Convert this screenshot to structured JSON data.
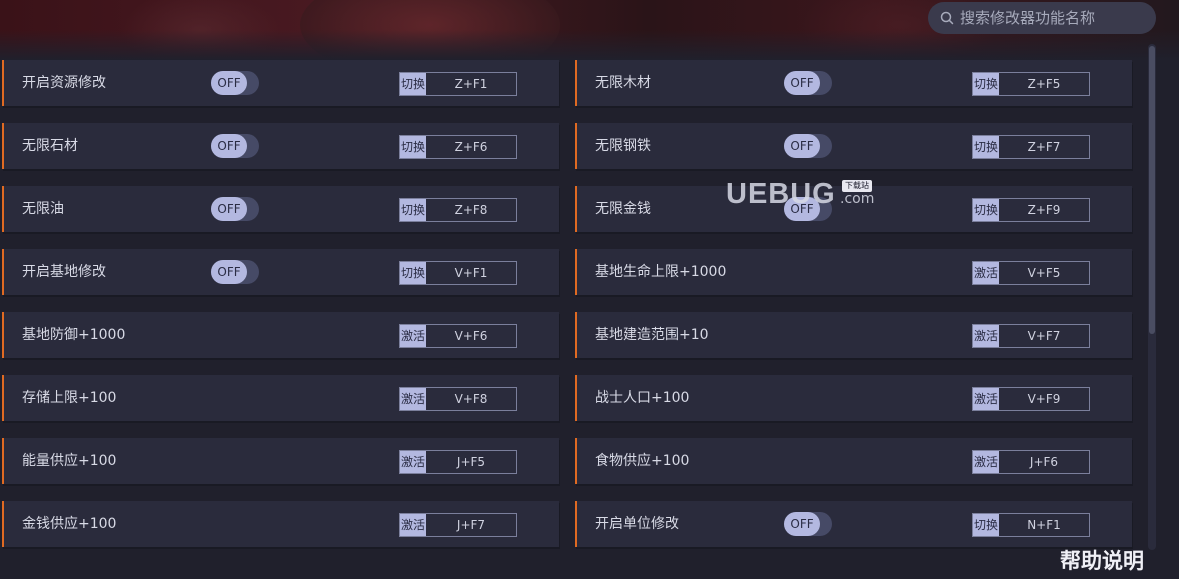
{
  "search": {
    "placeholder": "搜索修改器功能名称"
  },
  "toggle_off_label": "OFF",
  "rows_left": [
    {
      "label": "开启资源修改",
      "toggle": true,
      "action": "切换",
      "key": "Z+F1"
    },
    {
      "label": "无限石材",
      "toggle": true,
      "action": "切换",
      "key": "Z+F6"
    },
    {
      "label": "无限油",
      "toggle": true,
      "action": "切换",
      "key": "Z+F8"
    },
    {
      "label": "开启基地修改",
      "toggle": true,
      "action": "切换",
      "key": "V+F1"
    },
    {
      "label": "基地防御+1000",
      "toggle": false,
      "action": "激活",
      "key": "V+F6"
    },
    {
      "label": "存储上限+100",
      "toggle": false,
      "action": "激活",
      "key": "V+F8"
    },
    {
      "label": "能量供应+100",
      "toggle": false,
      "action": "激活",
      "key": "J+F5"
    },
    {
      "label": "金钱供应+100",
      "toggle": false,
      "action": "激活",
      "key": "J+F7"
    }
  ],
  "rows_right": [
    {
      "label": "无限木材",
      "toggle": true,
      "action": "切换",
      "key": "Z+F5"
    },
    {
      "label": "无限钢铁",
      "toggle": true,
      "action": "切换",
      "key": "Z+F7"
    },
    {
      "label": "无限金钱",
      "toggle": true,
      "action": "切换",
      "key": "Z+F9"
    },
    {
      "label": "基地生命上限+1000",
      "toggle": false,
      "action": "激活",
      "key": "V+F5"
    },
    {
      "label": "基地建造范围+10",
      "toggle": false,
      "action": "激活",
      "key": "V+F7"
    },
    {
      "label": "战士人口+100",
      "toggle": false,
      "action": "激活",
      "key": "V+F9"
    },
    {
      "label": "食物供应+100",
      "toggle": false,
      "action": "激活",
      "key": "J+F6"
    },
    {
      "label": "开启单位修改",
      "toggle": true,
      "action": "切换",
      "key": "N+F1"
    }
  ],
  "watermark": {
    "text": "UEBUG",
    "badge": "下载站",
    "suffix": ".com"
  },
  "help_label": "帮助说明",
  "colors": {
    "accent": "#e06a22",
    "row_bg": "#2a2b3c",
    "page_bg": "#20202c",
    "toggle_knob": "#b3b8e0"
  }
}
